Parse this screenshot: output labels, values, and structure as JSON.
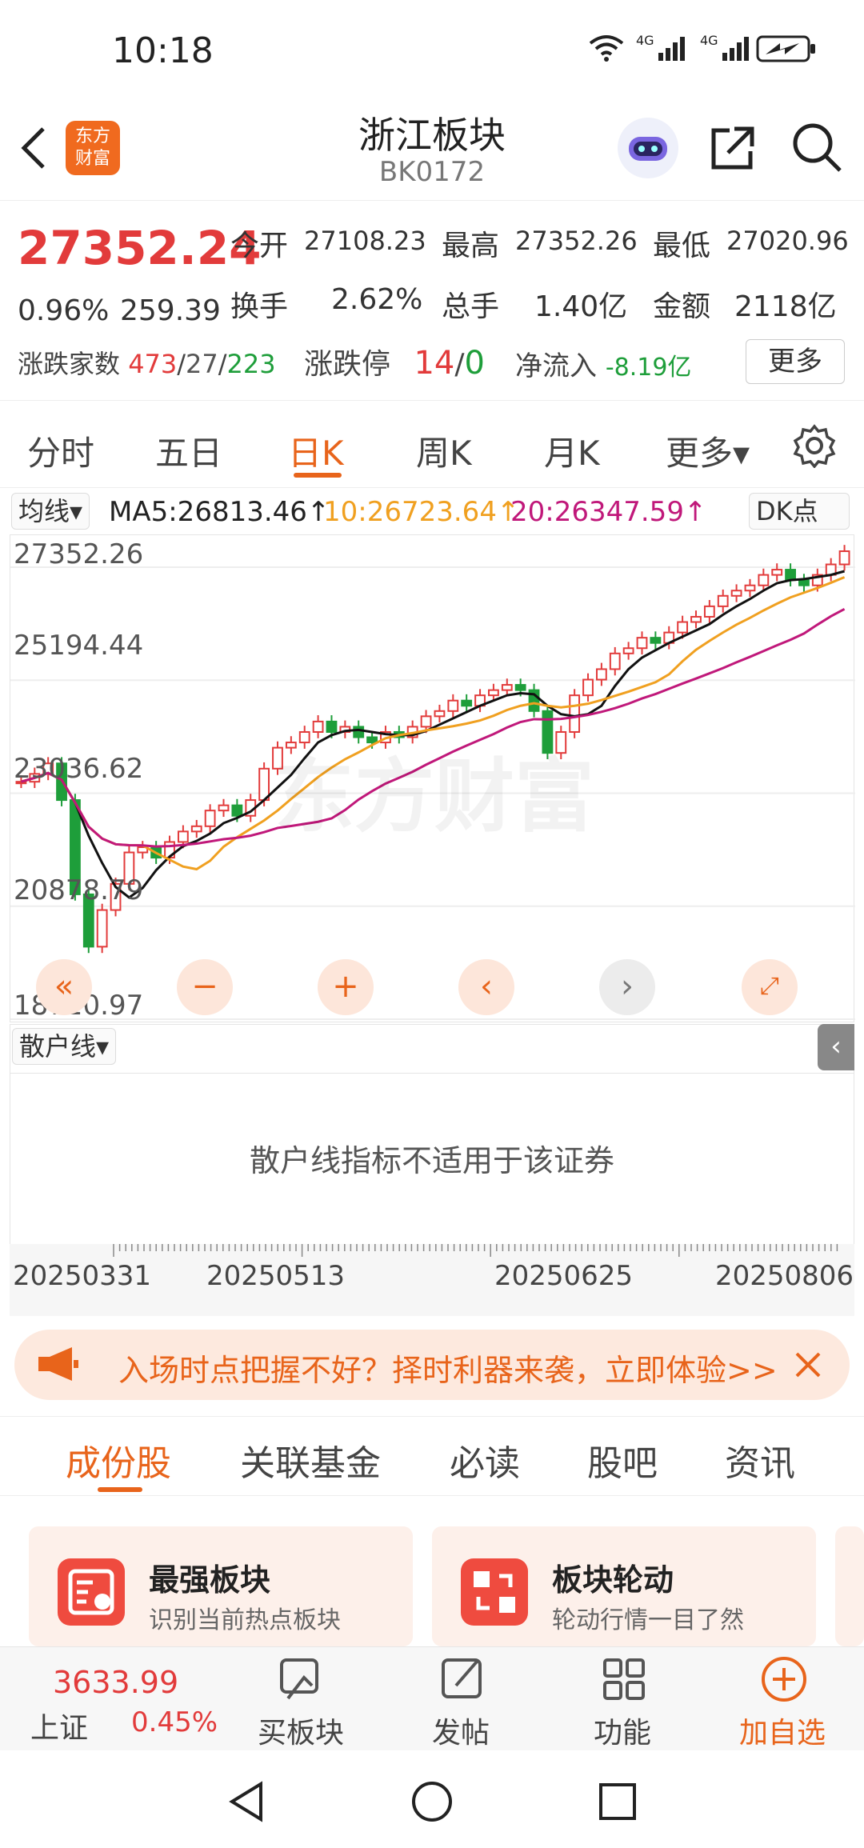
{
  "status": {
    "time": "10:18"
  },
  "header": {
    "title": "浙江板块",
    "code": "BK0172",
    "logo_line1": "东方",
    "logo_line2": "财富"
  },
  "quote": {
    "price": "27352.24",
    "change_pct": "0.96%",
    "change": "259.39",
    "open_label": "今开",
    "open": "27108.23",
    "high_label": "最高",
    "high": "27352.26",
    "low_label": "最低",
    "low": "27020.96",
    "turnover_label": "换手",
    "turnover": "2.62%",
    "volume_label": "总手",
    "volume": "1.40亿",
    "amount_label": "金额",
    "amount": "2118亿",
    "breadth_label": "涨跌家数",
    "breadth_up": "473",
    "breadth_flat": "27",
    "breadth_down": "223",
    "limit_label": "涨跌停",
    "limit_up": "14",
    "limit_down": "0",
    "inflow_label": "净流入",
    "inflow": "-8.19亿",
    "more": "更多"
  },
  "tabs": [
    "分时",
    "五日",
    "日K",
    "周K",
    "月K",
    "更多▾"
  ],
  "ma": {
    "selector": "均线▾",
    "ma5": "MA5:26813.46↑",
    "ma10": "10:26723.64↑",
    "ma20": "20:26347.59↑",
    "dk": "DK点"
  },
  "chart_data": {
    "type": "candlestick",
    "y_ticks": [
      "27352.26",
      "25194.44",
      "23036.62",
      "20878.79",
      "18720.97"
    ],
    "ylim": [
      18720.97,
      27352.26
    ],
    "x_ticks": [
      "20250331",
      "20250513",
      "20250625",
      "20250806"
    ],
    "series": [
      {
        "name": "MA5",
        "color": "#111111"
      },
      {
        "name": "10",
        "color": "#f0a020"
      },
      {
        "name": "20",
        "color": "#c0187a"
      }
    ],
    "close": [
      22950,
      23100,
      23300,
      22600,
      20800,
      19800,
      20500,
      21000,
      21600,
      21700,
      21500,
      21800,
      22000,
      22100,
      22400,
      22500,
      22300,
      22600,
      23200,
      23600,
      23700,
      23900,
      24100,
      23900,
      24000,
      23800,
      23700,
      23900,
      23800,
      24000,
      24200,
      24300,
      24500,
      24400,
      24600,
      24700,
      24800,
      24700,
      24300,
      23500,
      23900,
      24600,
      24900,
      25100,
      25400,
      25500,
      25700,
      25600,
      25800,
      26000,
      26100,
      26300,
      26500,
      26600,
      26700,
      26900,
      27000,
      26800,
      26700,
      26900,
      27100,
      27352
    ]
  },
  "subchart": {
    "selector": "散户线▾",
    "message": "散户线指标不适用于该证券"
  },
  "banner": {
    "text": "入场时点把握不好？择时利器来袭，立即体验>>"
  },
  "section_tabs": [
    "成份股",
    "关联基金",
    "必读",
    "股吧",
    "资讯"
  ],
  "cards": [
    {
      "title": "最强板块",
      "sub": "识别当前热点板块"
    },
    {
      "title": "板块轮动",
      "sub": "轮动行情一目了然"
    }
  ],
  "bottom": {
    "index_value": "3633.99",
    "index_name": "上证",
    "index_change": "0.45%",
    "buy": "买板块",
    "post": "发帖",
    "func": "功能",
    "add": "加自选"
  },
  "colors": {
    "accent": "#e8641b",
    "up": "#e23b3b",
    "down": "#1e9e3a"
  }
}
